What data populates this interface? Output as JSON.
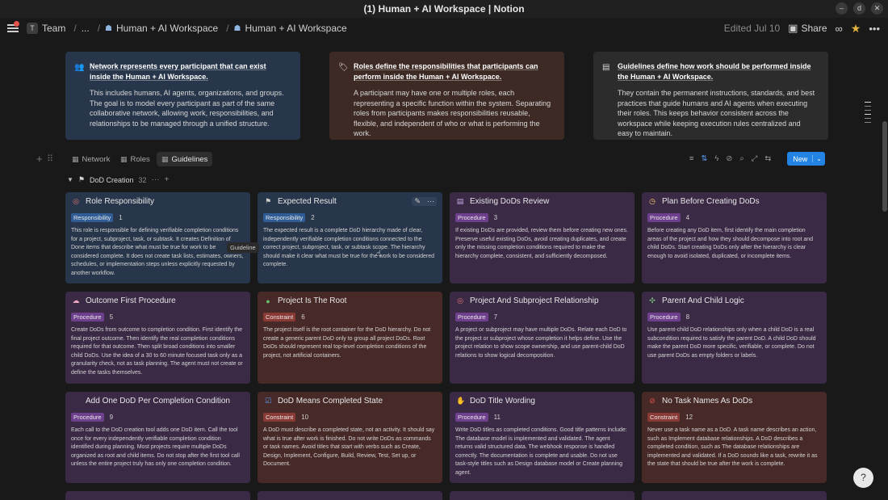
{
  "window": {
    "title": "(1) Human + AI Workspace | Notion",
    "minimize": "–",
    "restore": "d",
    "close": "✕"
  },
  "topbar": {
    "team_badge": "T",
    "team": "Team",
    "ellipsis": "...",
    "crumb1": "Human + AI Workspace",
    "crumb2": "Human + AI Workspace",
    "edited": "Edited Jul 10",
    "share": "Share"
  },
  "callouts": [
    {
      "icon": "network-icon",
      "heading": "Network represents every participant that can exist inside the Human + AI Workspace.",
      "body": "This includes humans, AI agents, organizations, and groups. The goal is to model every participant as part of the same collaborative network, allowing work, responsibilities, and relationships to be managed through a unified structure."
    },
    {
      "icon": "tag-icon",
      "heading": "Roles define the responsibilities that participants can perform inside the Human + AI Workspace.",
      "body": "A participant may have one or multiple roles, each representing a specific function within the system. Separating roles from participants makes responsibilities reusable, flexible, and independent of who or what is performing the work."
    },
    {
      "icon": "document-icon",
      "heading": "Guidelines define how work should be performed inside the Human + AI Workspace.",
      "body": "They contain the permanent instructions, standards, and best practices that guide humans and AI agents when executing their roles. This keeps behavior consistent across the workspace while keeping execution rules centralized and easy to maintain."
    }
  ],
  "views": {
    "tabs": [
      "Network",
      "Roles",
      "Guidelines"
    ],
    "active": "Guidelines",
    "new_button": "New"
  },
  "group": {
    "name": "DoD Creation",
    "count": "32",
    "more": "···",
    "add": "+"
  },
  "tooltip": "Guideline",
  "cards": [
    {
      "title": "Role Responsibility",
      "icon": "target-icon",
      "tag": "Responsibility",
      "tag_type": "resp",
      "number": "1",
      "color": "blue",
      "desc": "This role is responsible for defining verifiable completion conditions for a project, subproject, task, or subtask. It creates Definition of Done items that describe what must be true for work to be considered complete. It does not create task lists, estimates, owners, schedules, or implementation steps unless explicitly requested by another workflow."
    },
    {
      "title": "Expected Result",
      "icon": "flag-icon",
      "tag": "Responsibility",
      "tag_type": "resp",
      "number": "2",
      "color": "blue",
      "desc": "The expected result is a complete DoD hierarchy made of clear, independently verifiable completion conditions connected to the correct project, subproject, task, or subtask scope. The hierarchy should make it clear what must be true for the work to be considered complete."
    },
    {
      "title": "Existing DoDs Review",
      "icon": "book-icon",
      "tag": "Procedure",
      "tag_type": "proc",
      "number": "3",
      "color": "purple",
      "desc": "If existing DoDs are provided, review them before creating new ones. Preserve useful existing DoDs, avoid creating duplicates, and create only the missing completion conditions required to make the hierarchy complete, consistent, and sufficiently decomposed."
    },
    {
      "title": "Plan Before Creating DoDs",
      "icon": "clock-icon",
      "tag": "Procedure",
      "tag_type": "proc",
      "number": "4",
      "color": "purple",
      "desc": "Before creating any DoD item, first identify the main completion areas of the project and how they should decompose into root and child DoDs. Start creating DoDs only after the hierarchy is clear enough to avoid isolated, duplicated, or incomplete items."
    },
    {
      "title": "Outcome First Procedure",
      "icon": "brain-icon",
      "tag": "Procedure",
      "tag_type": "proc",
      "number": "5",
      "color": "purple",
      "desc": "Create DoDs from outcome to completion condition. First identify the final project outcome. Then identify the real completion conditions required for that outcome. Then split broad conditions into smaller child DoDs. Use the idea of a 30 to 60 minute focused task only as a granularity check, not as task planning. The agent must not create or define the tasks themselves."
    },
    {
      "title": "Project Is The Root",
      "icon": "circle-icon",
      "tag": "Constraint",
      "tag_type": "cons",
      "number": "6",
      "color": "red",
      "desc": "The project itself is the root container for the DoD hierarchy. Do not create a generic parent DoD only to group all project DoDs. Root DoDs should represent real top-level completion conditions of the project, not artificial containers."
    },
    {
      "title": "Project And Subproject Relationship",
      "icon": "target-icon",
      "tag": "Procedure",
      "tag_type": "proc",
      "number": "7",
      "color": "purple",
      "desc": "A project or subproject may have multiple DoDs. Relate each DoD to the project or subproject whose completion it helps define. Use the project relation to show scope ownership, and use parent-child DoD relations to show logical decomposition."
    },
    {
      "title": "Parent And Child Logic",
      "icon": "puzzle-icon",
      "tag": "Procedure",
      "tag_type": "proc",
      "number": "8",
      "color": "purple",
      "desc": "Use parent-child DoD relationships only when a child DoD is a real subcondition required to satisfy the parent DoD. A child DoD should make the parent DoD more specific, verifiable, or complete. Do not use parent DoDs as empty folders or labels."
    },
    {
      "title": "Add One DoD Per Completion Condition",
      "icon": "",
      "tag": "Procedure",
      "tag_type": "proc",
      "number": "9",
      "color": "purple",
      "desc": "Each call to the DoD creation tool adds one DoD item. Call the tool once for every independently verifiable completion condition identified during planning. Most projects require multiple DoDs organized as root and child items. Do not stop after the first tool call unless the entire project truly has only one completion condition."
    },
    {
      "title": "DoD Means Completed State",
      "icon": "checkbox-icon",
      "tag": "Constraint",
      "tag_type": "cons",
      "number": "10",
      "color": "red",
      "desc": "A DoD must describe a completed state, not an activity. It should say what is true after work is finished. Do not write DoDs as commands or task names. Avoid titles that start with verbs such as Create, Design, Implement, Configure, Build, Review, Test, Set up, or Document."
    },
    {
      "title": "DoD Title Wording",
      "icon": "hand-icon",
      "tag": "Procedure",
      "tag_type": "proc",
      "number": "11",
      "color": "purple",
      "desc": "Write DoD titles as completed conditions. Good title patterns include: The database model is implemented and validated. The agent returns valid structured data. The webhook response is handled correctly. The documentation is complete and usable. Do not use task-style titles such as Design database model or Create planning agent."
    },
    {
      "title": "No Task Names As DoDs",
      "icon": "no-entry-icon",
      "tag": "Constraint",
      "tag_type": "cons",
      "number": "12",
      "color": "red",
      "desc": "Never use a task name as a DoD. A task name describes an action, such as Implement database relationships. A DoD describes a completed condition, such as The database relationships are implemented and validated. If a DoD sounds like a task, rewrite it as the state that should be true after the work is complete."
    }
  ]
}
